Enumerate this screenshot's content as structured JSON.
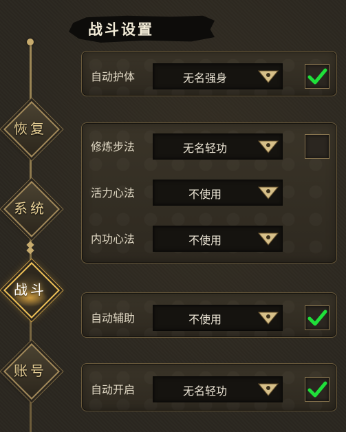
{
  "title": "战斗设置",
  "nav": {
    "items": [
      {
        "label": "恢复",
        "active": false
      },
      {
        "label": "系统",
        "active": false
      },
      {
        "label": "战斗",
        "active": true
      },
      {
        "label": "账号",
        "active": false
      }
    ]
  },
  "panels": {
    "auto_protect": {
      "label": "自动护体",
      "value": "无名强身",
      "checked": true
    },
    "cultivation": {
      "move": {
        "label": "修炼步法",
        "value": "无名轻功",
        "checked": false
      },
      "vitality": {
        "label": "活力心法",
        "value": "不使用"
      },
      "inner": {
        "label": "内功心法",
        "value": "不使用"
      }
    },
    "auto_assist": {
      "label": "自动辅助",
      "value": "不使用",
      "checked": true
    },
    "auto_start": {
      "label": "自动开启",
      "value": "无名轻功",
      "checked": true
    }
  },
  "colors": {
    "accent_gold": "#c7ab6d",
    "check_green": "#1fe03a",
    "active_glow": "#f0c257"
  }
}
